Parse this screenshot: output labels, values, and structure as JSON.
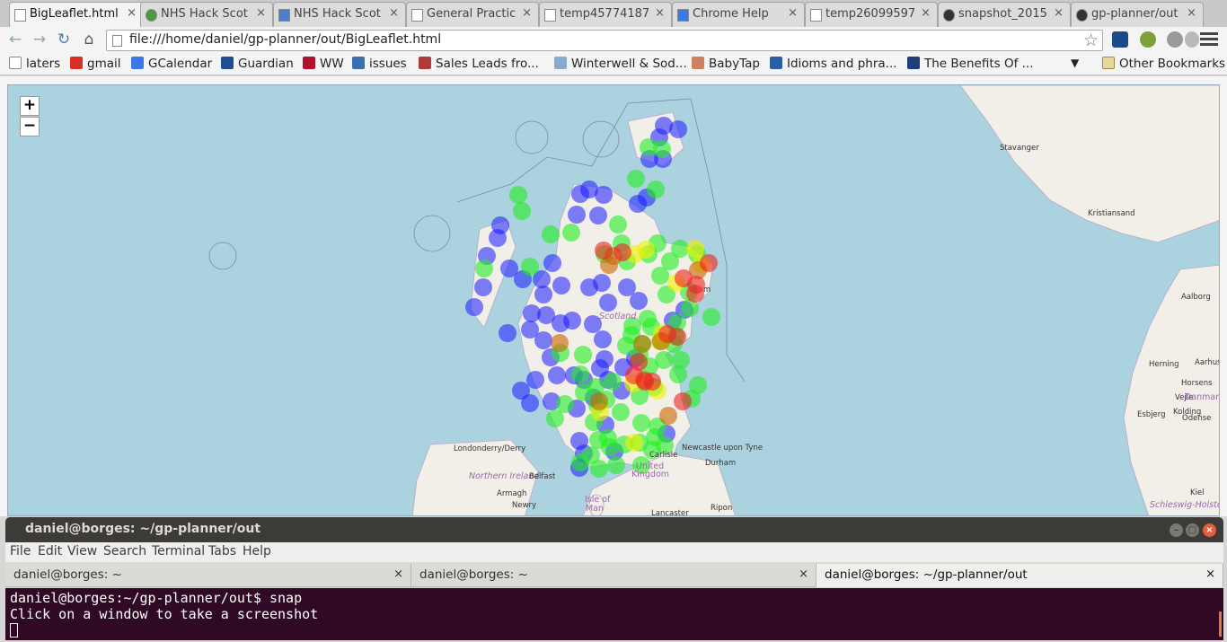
{
  "browser": {
    "tabs": [
      {
        "title": "BigLeaflet.html",
        "icon": "page-icon",
        "active": true
      },
      {
        "title": "NHS Hack Scot",
        "icon": "nhs-icon"
      },
      {
        "title": "NHS Hack Scot",
        "icon": "doc-icon"
      },
      {
        "title": "General Practic",
        "icon": "page-icon"
      },
      {
        "title": "temp45774187",
        "icon": "page-icon"
      },
      {
        "title": "Chrome Help",
        "icon": "google-icon"
      },
      {
        "title": "temp26099597",
        "icon": "page-icon"
      },
      {
        "title": "snapshot_2015",
        "icon": "github-icon"
      },
      {
        "title": "gp-planner/out",
        "icon": "github-icon"
      }
    ],
    "url": "file:///home/daniel/gp-planner/out/BigLeaflet.html",
    "bookmarks": [
      {
        "label": "laters",
        "icon": "doc-icon",
        "color": "#ffffff"
      },
      {
        "label": "gmail",
        "icon": "gmail-icon",
        "color": "#d93025"
      },
      {
        "label": "GCalendar",
        "icon": "gcalendar-icon",
        "color": "#3b78e7"
      },
      {
        "label": "Guardian",
        "icon": "guardian-icon",
        "color": "#214e8f"
      },
      {
        "label": "WW",
        "icon": "ww-icon",
        "color": "#b01030"
      },
      {
        "label": "issues",
        "icon": "issues-icon",
        "color": "#3a6fb0"
      },
      {
        "label": "Sales Leads fro...",
        "icon": "sales-icon",
        "color": "#b03a3a"
      },
      {
        "label": "Winterwell & Sod...",
        "icon": "winterwell-icon",
        "color": "#88aacc"
      },
      {
        "label": "BabyTap",
        "icon": "babytap-icon",
        "color": "#d08060"
      },
      {
        "label": "Idioms and phra...",
        "icon": "idioms-icon",
        "color": "#2b5ea6"
      },
      {
        "label": "The Benefits Of ...",
        "icon": "benefits-icon",
        "color": "#1f3f7a"
      }
    ],
    "bookmarks_more": "▼",
    "other_bookmarks": "Other Bookmarks",
    "zoom_in": "+",
    "zoom_out": "−"
  },
  "map": {
    "labels": [
      {
        "text": "Stavanger",
        "kind": "city"
      },
      {
        "text": "Kristiansand",
        "kind": "city"
      },
      {
        "text": "Aalborg",
        "kind": "city"
      },
      {
        "text": "Herning",
        "kind": "city"
      },
      {
        "text": "Aarhus",
        "kind": "city"
      },
      {
        "text": "Horsens",
        "kind": "city"
      },
      {
        "text": "Vejle",
        "kind": "city"
      },
      {
        "text": "Danmar",
        "kind": "country"
      },
      {
        "text": "Kolding",
        "kind": "city"
      },
      {
        "text": "Odense",
        "kind": "city"
      },
      {
        "text": "Esbjerg",
        "kind": "city"
      },
      {
        "text": "Kiel",
        "kind": "city"
      },
      {
        "text": "Schleswig-Holstein",
        "kind": "region"
      },
      {
        "text": "Scotland",
        "kind": "region"
      },
      {
        "text": "m",
        "kind": "city"
      },
      {
        "text": "Londonderry/Derry",
        "kind": "city"
      },
      {
        "text": "Northern Ireland",
        "kind": "region"
      },
      {
        "text": "Belfast",
        "kind": "city"
      },
      {
        "text": "Armagh",
        "kind": "city"
      },
      {
        "text": "Newry",
        "kind": "city"
      },
      {
        "text": "Isle of",
        "kind": "country"
      },
      {
        "text": "Man",
        "kind": "country"
      },
      {
        "text": "Carlisle",
        "kind": "city"
      },
      {
        "text": "United",
        "kind": "country"
      },
      {
        "text": "Kingdom",
        "kind": "country"
      },
      {
        "text": "Newcastle upon Tyne",
        "kind": "city"
      },
      {
        "text": "Durham",
        "kind": "city"
      },
      {
        "text": "Lancaster",
        "kind": "city"
      },
      {
        "text": "Ripon",
        "kind": "city"
      }
    ],
    "marker_colors": {
      "blue": "#1a1aff",
      "green": "#22ee22",
      "yellow": "#f0f000",
      "orange": "#c86400",
      "red": "#ee2222"
    }
  },
  "terminal": {
    "title": "daniel@borges: ~/gp-planner/out",
    "menu": [
      "File",
      "Edit",
      "View",
      "Search",
      "Terminal",
      "Tabs",
      "Help"
    ],
    "tabs": [
      {
        "label": "daniel@borges: ~"
      },
      {
        "label": "daniel@borges: ~"
      },
      {
        "label": "daniel@borges: ~/gp-planner/out"
      }
    ],
    "lines": [
      "daniel@borges:~/gp-planner/out$ snap",
      "Click on a window to take a screenshot"
    ],
    "close": "×"
  }
}
